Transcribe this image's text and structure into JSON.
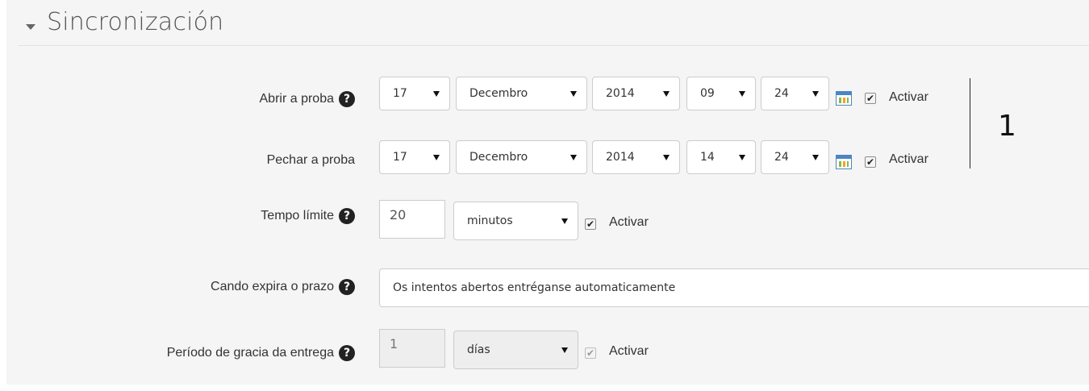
{
  "section": {
    "title": "Sincronización"
  },
  "rows": {
    "open": {
      "label": "Abrir a proba",
      "day": "17",
      "month": "Decembro",
      "year": "2014",
      "hour": "09",
      "minute": "24",
      "enable_label": "Activar",
      "enabled": true
    },
    "close": {
      "label": "Pechar a proba",
      "day": "17",
      "month": "Decembro",
      "year": "2014",
      "hour": "14",
      "minute": "24",
      "enable_label": "Activar",
      "enabled": true
    },
    "timelimit": {
      "label": "Tempo límite",
      "value": "20",
      "unit": "minutos",
      "enable_label": "Activar",
      "enabled": true
    },
    "overdue": {
      "label": "Cando expira o prazo",
      "value": "Os intentos abertos entréganse automaticamente"
    },
    "grace": {
      "label": "Período de gracia da entrega",
      "value": "1",
      "unit": "días",
      "enable_label": "Activar",
      "enabled": true
    }
  },
  "annotation": {
    "text": "1"
  },
  "icons": {
    "help": "question-circle-icon",
    "calendar": "calendar-icon",
    "collapse": "caret-down-icon"
  }
}
